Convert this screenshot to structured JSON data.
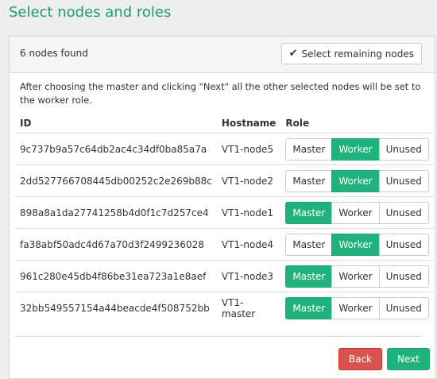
{
  "page": {
    "title": "Select nodes and roles"
  },
  "panel": {
    "nodes_found": "6 nodes found",
    "select_remaining_label": "Select remaining nodes",
    "info": "After choosing the master and clicking \"Next\" all the other selected nodes will be set to the worker role."
  },
  "table": {
    "headers": {
      "id": "ID",
      "hostname": "Hostname",
      "role": "Role"
    },
    "role_labels": [
      "Master",
      "Worker",
      "Unused"
    ],
    "rows": [
      {
        "id": "9c737b9a57c64db2ac4c34df0ba85a7a",
        "hostname": "VT1-node5",
        "role": "Worker"
      },
      {
        "id": "2dd527766708445db00252c2e269b88c",
        "hostname": "VT1-node2",
        "role": "Worker"
      },
      {
        "id": "898a8a1da27741258b4d0f1c7d257ce4",
        "hostname": "VT1-node1",
        "role": "Master"
      },
      {
        "id": "fa38abf50adc4d67a70d3f2499236028",
        "hostname": "VT1-node4",
        "role": "Worker"
      },
      {
        "id": "961c280e45db4f86be31ea723a1e8aef",
        "hostname": "VT1-node3",
        "role": "Master"
      },
      {
        "id": "32bb549557154a44beacde4f508752bb",
        "hostname": "VT1-master",
        "role": "Master"
      }
    ]
  },
  "footer": {
    "back_label": "Back",
    "next_label": "Next"
  },
  "colors": {
    "accent": "#1fb27d",
    "title": "#1c9c6e",
    "danger": "#d9534f"
  },
  "icons": {
    "select_remaining": "check-icon"
  }
}
